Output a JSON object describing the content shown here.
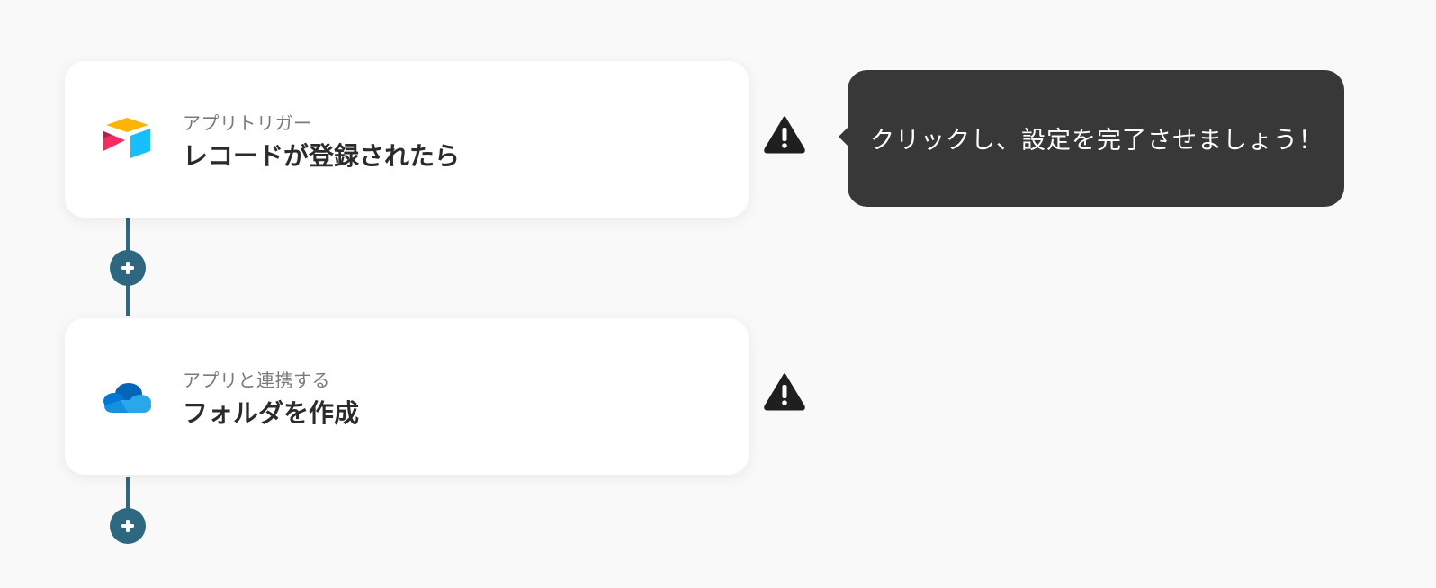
{
  "flow": {
    "steps": [
      {
        "app": "airtable",
        "icon": "airtable-logo-icon",
        "kicker": "アプリトリガー",
        "title": "レコードが登録されたら",
        "status_icon": "warning-icon"
      },
      {
        "app": "onedrive",
        "icon": "onedrive-logo-icon",
        "kicker": "アプリと連携する",
        "title": "フォルダを作成",
        "status_icon": "warning-icon"
      }
    ],
    "add_step_icon": "plus-icon"
  },
  "tooltip": {
    "text": "クリックし、設定を完了させましょう！"
  },
  "colors": {
    "background": "#f9f9f9",
    "connector": "#2d6880",
    "tooltip_bg": "#383838",
    "warning": "#1f1f1f"
  }
}
